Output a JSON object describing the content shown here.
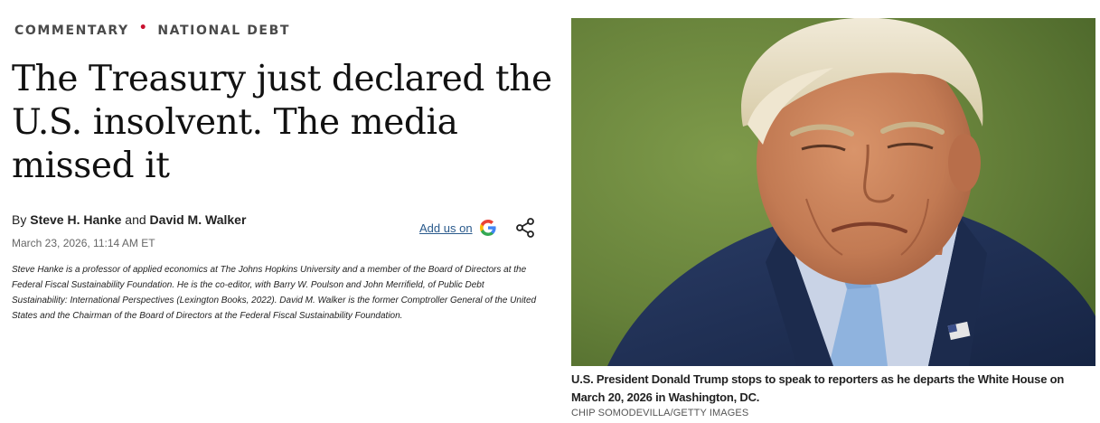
{
  "article": {
    "kicker": {
      "section": "COMMENTARY",
      "separator": "•",
      "topic": "NATIONAL DEBT"
    },
    "headline": "The Treasury just declared the U.S. insolvent. The media missed it",
    "byline": {
      "prefix": "By",
      "author1": "Steve H. Hanke",
      "conjunction": "and",
      "author2": "David M. Walker"
    },
    "date": "March 23, 2026, 11:14 AM ET",
    "add_us": {
      "label": "Add us on",
      "icon": "google-icon"
    },
    "share_icon": "share-icon",
    "bio": "Steve Hanke is a professor of applied economics at The Johns Hopkins University and a member of the Board of Directors at the Federal Fiscal Sustainability Foundation. He is the co-editor, with Barry W. Poulson and John Merrifield, of Public Debt Sustainability: International Perspectives (Lexington Books, 2022). David M. Walker is the former Comptroller General of the United States and the Chairman of the Board of Directors at the Federal Fiscal Sustainability Foundation."
  },
  "image": {
    "caption": "U.S. President Donald Trump stops to speak to reporters as he departs the White House on March 20, 2026 in Washington, DC.",
    "credit": "CHIP SOMODEVILLA/GETTY IMAGES"
  },
  "colors": {
    "kicker_dot": "#c8102e",
    "link": "#2a5a8c",
    "photo_background": "#6f8a3e",
    "suit": "#1f2f52"
  }
}
